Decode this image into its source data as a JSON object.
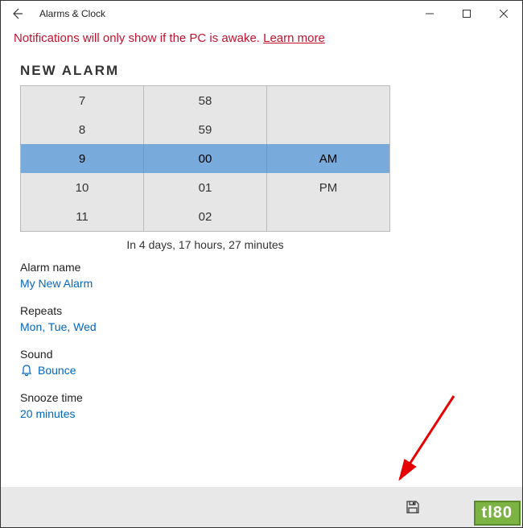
{
  "window": {
    "title": "Alarms & Clock"
  },
  "notification": {
    "text": "Notifications will only show if the PC is awake. ",
    "link": "Learn more"
  },
  "page_title": "NEW ALARM",
  "time_picker": {
    "hours": [
      "7",
      "8",
      "9",
      "10",
      "11"
    ],
    "minutes": [
      "58",
      "59",
      "00",
      "01",
      "02"
    ],
    "ampm": [
      "",
      "",
      "AM",
      "PM",
      ""
    ],
    "selected_index": 2
  },
  "countdown": "In 4 days, 17 hours, 27 minutes",
  "fields": {
    "alarm_name": {
      "label": "Alarm name",
      "value": "My New Alarm"
    },
    "repeats": {
      "label": "Repeats",
      "value": "Mon, Tue, Wed"
    },
    "sound": {
      "label": "Sound",
      "value": "Bounce"
    },
    "snooze": {
      "label": "Snooze time",
      "value": "20 minutes"
    }
  },
  "annotation_logo": "tl80"
}
